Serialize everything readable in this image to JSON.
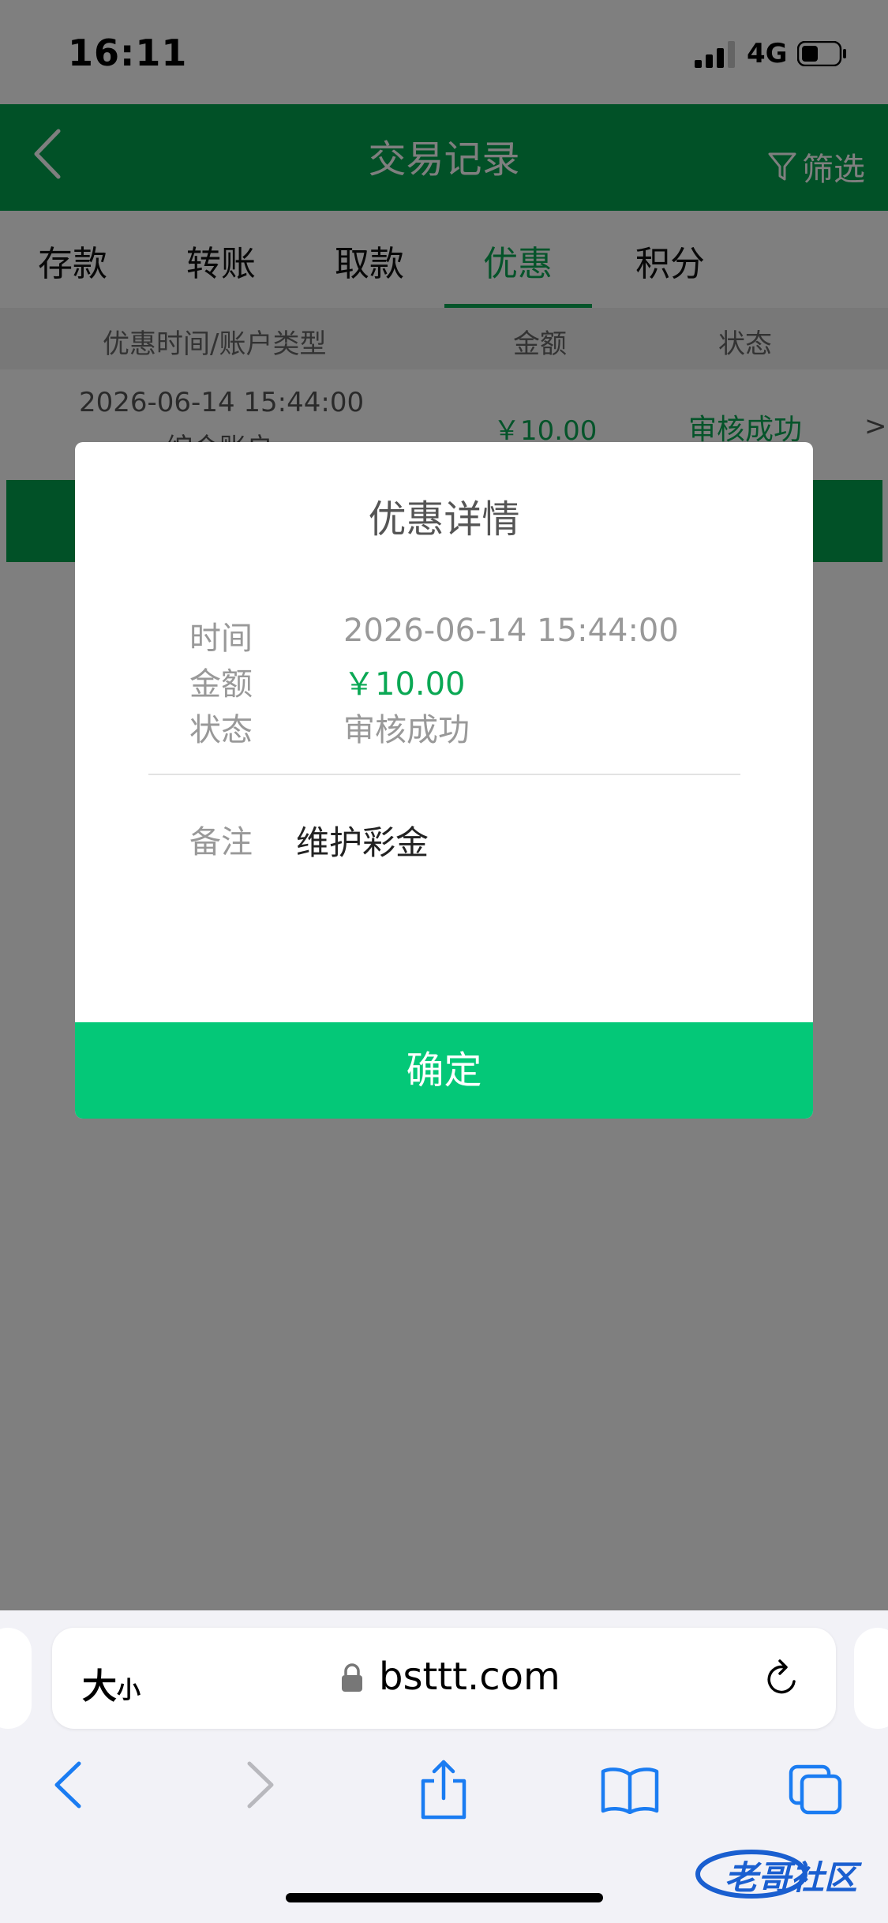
{
  "status_bar": {
    "time": "16:11",
    "network": "4G"
  },
  "header": {
    "title": "交易记录",
    "filter_label": "筛选"
  },
  "tabs": [
    {
      "label": "存款",
      "active": false
    },
    {
      "label": "转账",
      "active": false
    },
    {
      "label": "取款",
      "active": false
    },
    {
      "label": "优惠",
      "active": true
    },
    {
      "label": "积分",
      "active": false
    }
  ],
  "table": {
    "columns": [
      "优惠时间/账户类型",
      "金额",
      "状态"
    ],
    "rows": [
      {
        "time": "2026-06-14 15:44:00",
        "account_type": "综合账户",
        "amount": "￥10.00",
        "status": "审核成功"
      }
    ]
  },
  "dialog": {
    "title": "优惠详情",
    "fields": [
      {
        "label": "时间",
        "value": "2026-06-14 15:44:00"
      },
      {
        "label": "金额",
        "value": "￥10.00"
      },
      {
        "label": "状态",
        "value": "审核成功"
      }
    ],
    "note_label": "备注",
    "note_value": "维护彩金",
    "confirm_label": "确定"
  },
  "browser": {
    "text_size_label": "大",
    "text_size_small": "小",
    "url": "bsttt.com"
  },
  "watermark": {
    "text": "老哥社区"
  },
  "colors": {
    "brand_green": "#02a24e",
    "accent_green": "#0aa854",
    "button_green": "#04c878"
  }
}
